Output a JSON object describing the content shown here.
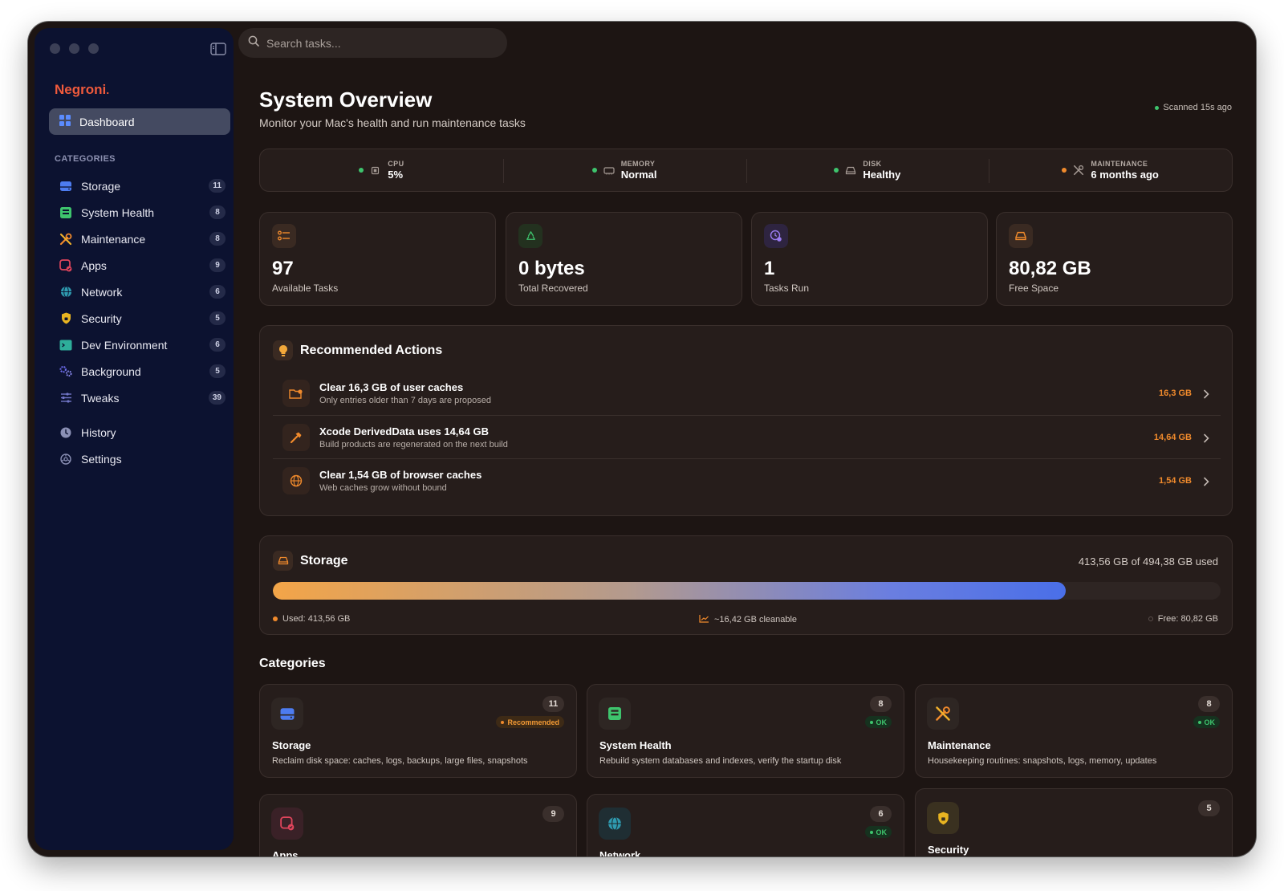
{
  "sidebar": {
    "brand": "Negroni",
    "active_item": "Dashboard",
    "categories_heading": "CATEGORIES",
    "items": [
      {
        "label": "Storage",
        "count": "11",
        "icon": "storage-icon",
        "color": "#4d7cf0"
      },
      {
        "label": "System Health",
        "count": "8",
        "icon": "system-health-icon",
        "color": "#3ec46d"
      },
      {
        "label": "Maintenance",
        "count": "8",
        "icon": "maintenance-icon",
        "color": "#f08a2c"
      },
      {
        "label": "Apps",
        "count": "9",
        "icon": "apps-icon",
        "color": "#e0455c"
      },
      {
        "label": "Network",
        "count": "6",
        "icon": "network-icon",
        "color": "#2f9bb0"
      },
      {
        "label": "Security",
        "count": "5",
        "icon": "security-icon",
        "color": "#e8b421"
      },
      {
        "label": "Dev Environment",
        "count": "6",
        "icon": "dev-environment-icon",
        "color": "#2eae9a"
      },
      {
        "label": "Background",
        "count": "5",
        "icon": "background-icon",
        "color": "#6f6ef0"
      },
      {
        "label": "Tweaks",
        "count": "39",
        "icon": "tweaks-icon",
        "color": "#7276c8"
      }
    ],
    "bottom_items": [
      {
        "label": "History",
        "icon": "history-icon"
      },
      {
        "label": "Settings",
        "icon": "settings-icon"
      }
    ]
  },
  "search": {
    "placeholder": "Search tasks..."
  },
  "header": {
    "title": "System Overview",
    "subtitle": "Monitor your Mac's health and run maintenance tasks",
    "scanned": "Scanned 15s ago"
  },
  "status": [
    {
      "label": "CPU",
      "value": "5%",
      "icon": "cpu-icon",
      "dot": "#3ec46d"
    },
    {
      "label": "MEMORY",
      "value": "Normal",
      "icon": "memory-icon",
      "dot": "#3ec46d"
    },
    {
      "label": "DISK",
      "value": "Healthy",
      "icon": "disk-icon",
      "dot": "#3ec46d"
    },
    {
      "label": "MAINTENANCE",
      "value": "6 months ago",
      "icon": "maintenance-icon",
      "dot": "#f08a2c"
    }
  ],
  "stats": [
    {
      "value": "97",
      "label": "Available Tasks",
      "icon": "tasks-list-icon"
    },
    {
      "value": "0 bytes",
      "label": "Total Recovered",
      "icon": "recycle-icon"
    },
    {
      "value": "1",
      "label": "Tasks Run",
      "icon": "tasks-run-icon"
    },
    {
      "value": "80,82 GB",
      "label": "Free Space",
      "icon": "disk-icon"
    }
  ],
  "recommended": {
    "title": "Recommended Actions",
    "items": [
      {
        "title": "Clear 16,3 GB of user caches",
        "desc": "Only entries older than 7 days are proposed",
        "size": "16,3 GB",
        "icon": "folder-badge-icon"
      },
      {
        "title": "Xcode DerivedData uses 14,64 GB",
        "desc": "Build products are regenerated on the next build",
        "size": "14,64 GB",
        "icon": "hammer-icon"
      },
      {
        "title": "Clear 1,54 GB of browser caches",
        "desc": "Web caches grow without bound",
        "size": "1,54 GB",
        "icon": "globe-icon"
      }
    ]
  },
  "storage": {
    "title": "Storage",
    "used_summary": "413,56 GB of 494,38 GB used",
    "used_fraction": 0.8365,
    "used_label": "Used: 413,56 GB",
    "cleanable_label": "~16,42 GB cleanable",
    "free_label": "Free: 80,82 GB"
  },
  "categories": {
    "title": "Categories",
    "items": [
      {
        "name": "Storage",
        "desc": "Reclaim disk space: caches, logs, backups, large files, snapshots",
        "count": "11",
        "badge": "Recommended",
        "badge_type": "recommended",
        "icon": "storage-icon"
      },
      {
        "name": "System Health",
        "desc": "Rebuild system databases and indexes, verify the startup disk",
        "count": "8",
        "badge": "OK",
        "badge_type": "ok",
        "icon": "system-health-icon"
      },
      {
        "name": "Maintenance",
        "desc": "Housekeeping routines: snapshots, logs, memory, updates",
        "count": "8",
        "badge": "OK",
        "badge_type": "ok",
        "icon": "maintenance-icon"
      },
      {
        "name": "Apps",
        "count": "9",
        "icon": "apps-icon"
      },
      {
        "name": "Network",
        "count": "6",
        "badge": "OK",
        "badge_type": "ok",
        "icon": "network-icon"
      },
      {
        "name": "Security",
        "count": "5",
        "icon": "security-icon"
      }
    ]
  }
}
